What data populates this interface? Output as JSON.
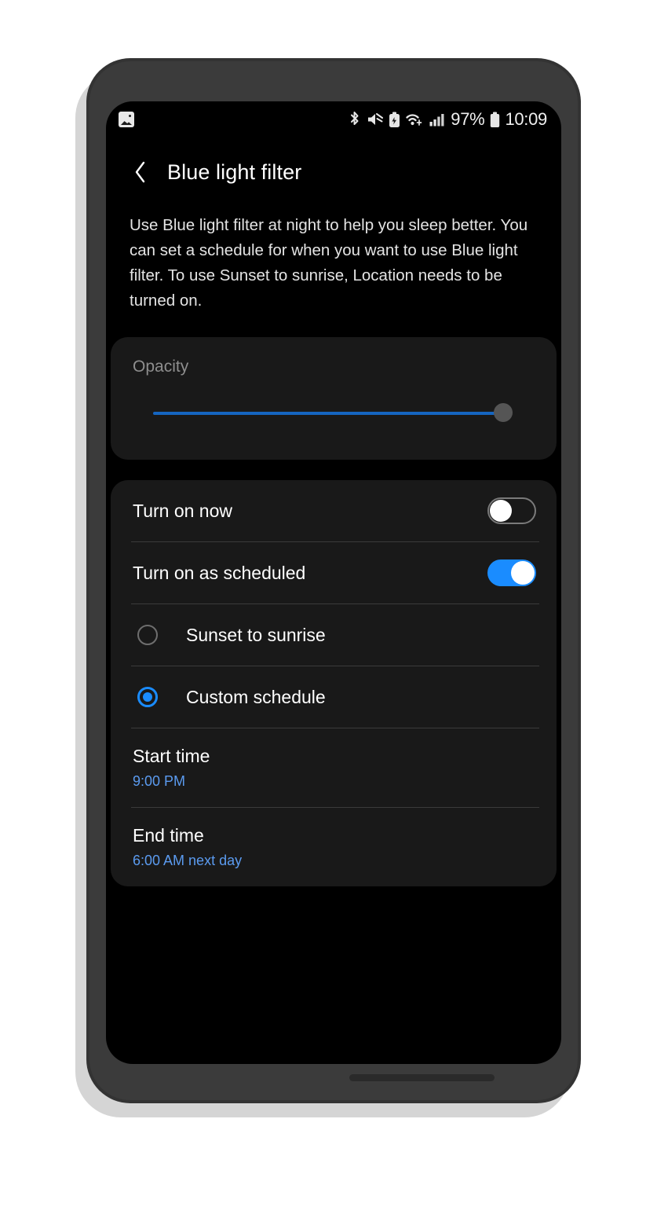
{
  "status_bar": {
    "notification_icon": "gallery-icon",
    "icons": [
      "bluetooth-icon",
      "mute-icon",
      "battery-saver-icon",
      "wifi-icon",
      "signal-icon"
    ],
    "battery_percent": "97%",
    "battery_icon": "battery-icon",
    "time": "10:09"
  },
  "app_bar": {
    "back_icon": "back-chevron-icon",
    "title": "Blue light filter"
  },
  "description": "Use Blue light filter at night to help you sleep better. You can set a schedule for when you want to use Blue light filter. To use Sunset to sunrise, Location needs to be turned on.",
  "opacity": {
    "label": "Opacity",
    "value_percent": 97
  },
  "settings": {
    "turn_on_now": {
      "label": "Turn on now",
      "state": "off"
    },
    "turn_on_as_scheduled": {
      "label": "Turn on as scheduled",
      "state": "on"
    },
    "schedule_options": [
      {
        "label": "Sunset to sunrise",
        "selected": false
      },
      {
        "label": "Custom schedule",
        "selected": true
      }
    ],
    "start_time": {
      "label": "Start time",
      "value": "9:00 PM"
    },
    "end_time": {
      "label": "End time",
      "value": "6:00 AM next day"
    }
  },
  "colors": {
    "accent_blue": "#1a8cff",
    "link_blue": "#5b9bf0",
    "slider_blue": "#1565c0",
    "card_bg": "#191919",
    "screen_bg": "#000000"
  }
}
